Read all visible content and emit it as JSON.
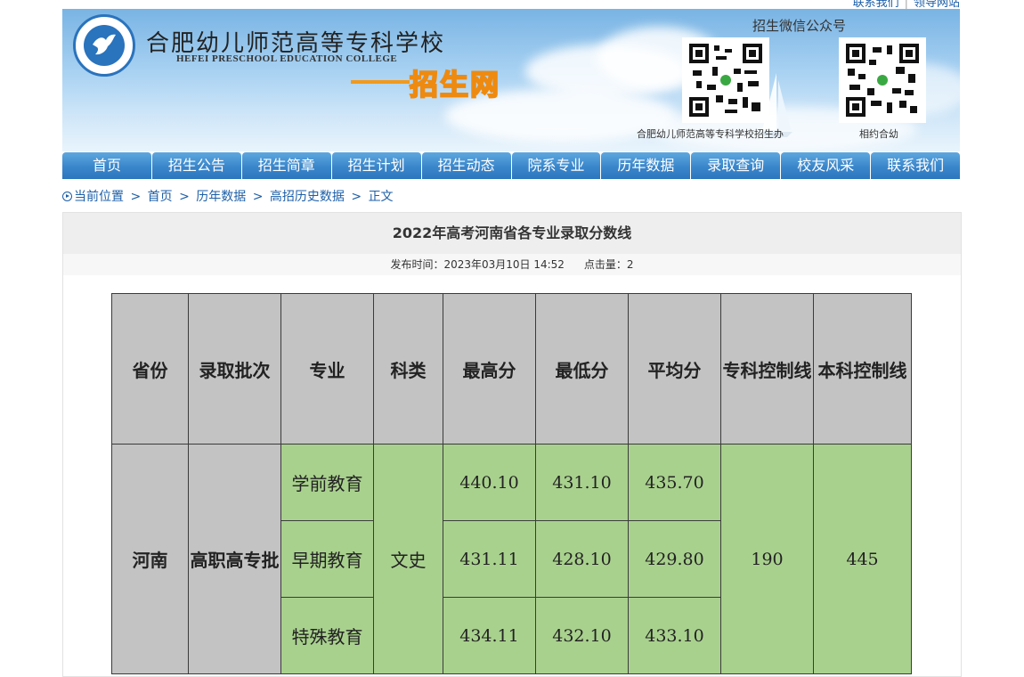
{
  "top_links": {
    "contact": "联系我们",
    "sep": "|",
    "leadership": "领导网站"
  },
  "header": {
    "school_cn": "合肥幼儿师范高等专科学校",
    "school_en": "HEFEI PRESCHOOL EDUCATION COLLEGE",
    "site_name": "招生网",
    "wechat_title": "招生微信公众号",
    "qr1_caption": "合肥幼儿师范高等专科学校招生办",
    "qr2_caption": "相约合幼"
  },
  "nav": [
    "首页",
    "招生公告",
    "招生简章",
    "招生计划",
    "招生动态",
    "院系专业",
    "历年数据",
    "录取查询",
    "校友风采",
    "联系我们"
  ],
  "breadcrumb": {
    "label": "当前位置",
    "items": [
      "首页",
      "历年数据",
      "高招历史数据",
      "正文"
    ],
    "sep": ">"
  },
  "article": {
    "title": "2022年高考河南省各专业录取分数线",
    "publish_time": "发布时间：2023年03月10日 14:52",
    "views": "点击量：2"
  },
  "table": {
    "headers": [
      "省份",
      "录取批次",
      "专业",
      "科类",
      "最高分",
      "最低分",
      "平均分",
      "专科控制线",
      "本科控制线"
    ],
    "province": "河南",
    "batch": "高职高专批",
    "category": "文史",
    "vocational_line": "190",
    "undergrad_line": "445",
    "rows": [
      {
        "major": "学前教育",
        "max": "440.10",
        "min": "431.10",
        "avg": "435.70"
      },
      {
        "major": "早期教育",
        "max": "431.11",
        "min": "428.10",
        "avg": "429.80"
      },
      {
        "major": "特殊教育",
        "max": "434.11",
        "min": "432.10",
        "avg": "433.10"
      }
    ]
  },
  "colors": {
    "nav": "#3a86cb",
    "header_cell": "#c3c3c3",
    "data_cell": "#a9d18e",
    "link": "#1d5fa8",
    "accent": "#ee8a10"
  }
}
